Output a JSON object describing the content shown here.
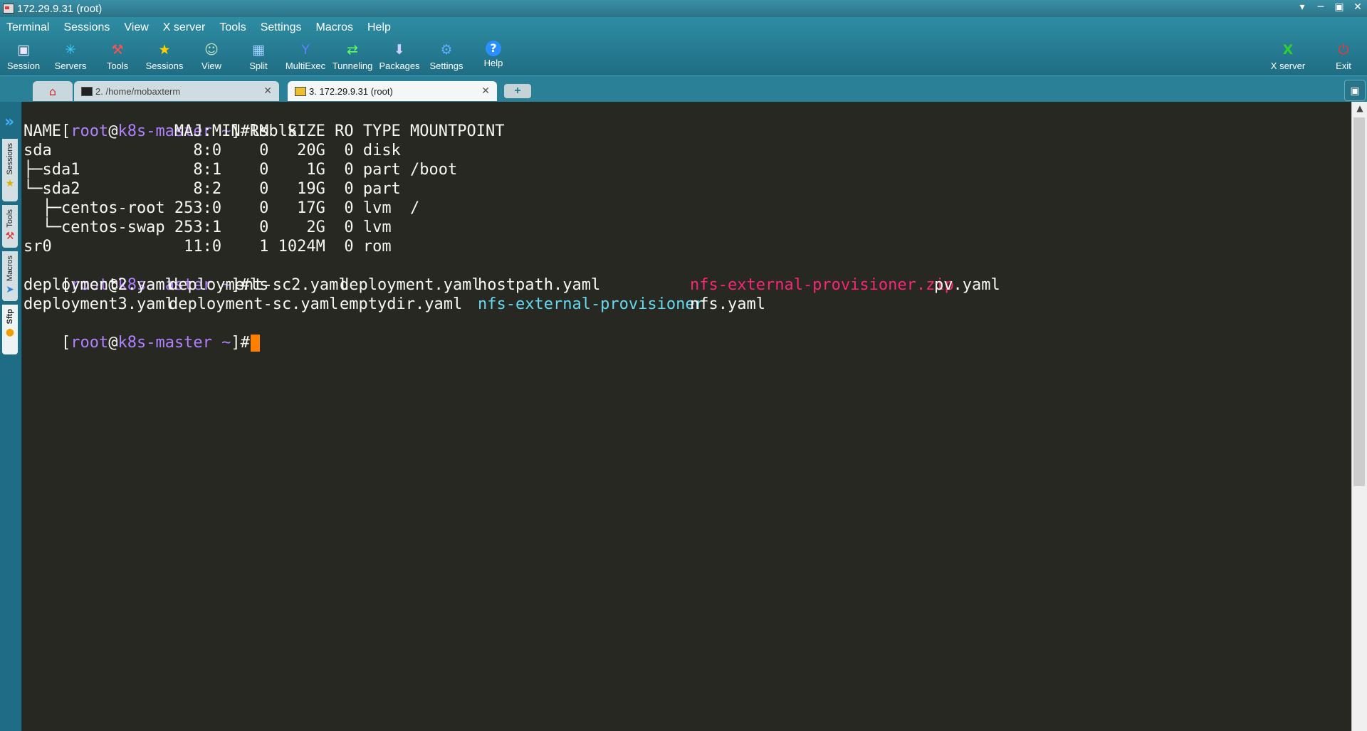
{
  "window": {
    "title": "172.29.9.31 (root)",
    "controls": [
      "▾",
      "─",
      "▣",
      "✕"
    ]
  },
  "menu": [
    "Terminal",
    "Sessions",
    "View",
    "X server",
    "Tools",
    "Settings",
    "Macros",
    "Help"
  ],
  "toolbar": {
    "items": [
      {
        "label": "Session",
        "icon": "session-icon",
        "glyph": "▣",
        "color": "#e8e8ff"
      },
      {
        "label": "Servers",
        "icon": "servers-icon",
        "glyph": "✳",
        "color": "#40d0ff"
      },
      {
        "label": "Tools",
        "icon": "tools-icon",
        "glyph": "⚒",
        "color": "#ff5050"
      },
      {
        "label": "Sessions",
        "icon": "star-icon",
        "glyph": "★",
        "color": "#ffd000"
      },
      {
        "label": "View",
        "icon": "view-icon",
        "glyph": "☺",
        "color": "#c0e0c0"
      },
      {
        "label": "Split",
        "icon": "split-icon",
        "glyph": "▦",
        "color": "#a0d0ff"
      },
      {
        "label": "MultiExec",
        "icon": "multiexec-icon",
        "glyph": "Y",
        "color": "#6080ff"
      },
      {
        "label": "Tunneling",
        "icon": "tunneling-icon",
        "glyph": "⇄",
        "color": "#60ff60"
      },
      {
        "label": "Packages",
        "icon": "packages-icon",
        "glyph": "⬇",
        "color": "#d0d0ff"
      },
      {
        "label": "Settings",
        "icon": "settings-icon",
        "glyph": "⚙",
        "color": "#60b0ff"
      },
      {
        "label": "Help",
        "icon": "help-icon",
        "glyph": "?",
        "color": "#ffffff"
      }
    ],
    "xserver": {
      "label": "X server",
      "icon": "xserver-icon",
      "glyph": "X",
      "color": "#30d030"
    },
    "exit": {
      "label": "Exit",
      "icon": "power-icon",
      "glyph": "⏻",
      "color": "#ff3030"
    }
  },
  "tabs": {
    "home_glyph": "⌂",
    "tab2": "2. /home/mobaxterm",
    "tab3": "3. 172.29.9.31 (root)",
    "close": "✕",
    "add": "+",
    "right": "▣"
  },
  "sidebar": {
    "arrow": "»",
    "sessions": "Sessions",
    "tools": "Tools",
    "macros": "Macros",
    "sftp": "Sftp"
  },
  "terminal": {
    "prompt": {
      "open": "[",
      "user": "root",
      "at": "@",
      "host": "k8s-master",
      "tilde": " ~",
      "close": "]#"
    },
    "cmd1": "lsblk",
    "lsblk": [
      "NAME            MAJ:MIN RM  SIZE RO TYPE MOUNTPOINT",
      "sda               8:0    0   20G  0 disk",
      "├─sda1            8:1    0    1G  0 part /boot",
      "└─sda2            8:2    0   19G  0 part",
      "  ├─centos-root 253:0    0   17G  0 lvm  /",
      "  └─centos-swap 253:1    0    2G  0 lvm",
      "sr0              11:0    1 1024M  0 rom"
    ],
    "cmd2": "ls",
    "ls_row1": [
      "deployment2.yaml",
      "deployment-sc2.yaml",
      "deployment.yaml",
      "hostpath.yaml",
      "nfs-external-provisioner.zip",
      "pv.yaml"
    ],
    "ls_row2": [
      "deployment3.yaml",
      "deployment-sc.yaml",
      "emptydir.yaml",
      "nfs-external-provisioner",
      "nfs.yaml"
    ],
    "colors": {
      "zip": "#f92672",
      "dir": "#66d9ef",
      "cursor": "#ff8000"
    }
  }
}
